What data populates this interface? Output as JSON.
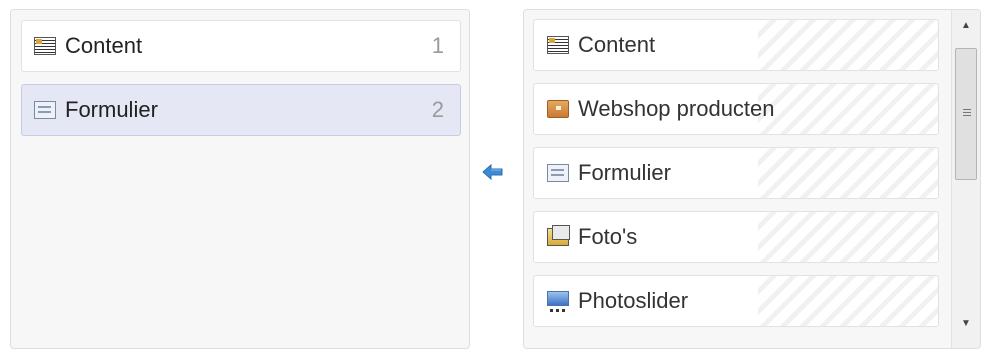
{
  "left_list": {
    "items": [
      {
        "label": "Content",
        "count": "1",
        "icon": "content-icon",
        "selected": false
      },
      {
        "label": "Formulier",
        "count": "2",
        "icon": "form-icon",
        "selected": true
      }
    ]
  },
  "right_list": {
    "items": [
      {
        "label": "Content",
        "icon": "content-icon"
      },
      {
        "label": "Webshop producten",
        "icon": "box-icon"
      },
      {
        "label": "Formulier",
        "icon": "form-icon"
      },
      {
        "label": "Foto's",
        "icon": "photos-icon"
      },
      {
        "label": "Photoslider",
        "icon": "slider-icon"
      }
    ]
  },
  "colors": {
    "selected_bg": "#e6e7f5",
    "arrow": "#3a8bd4"
  }
}
